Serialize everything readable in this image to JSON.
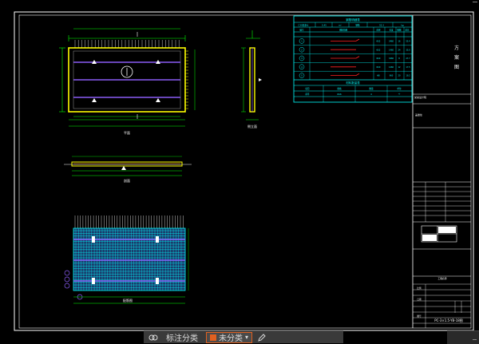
{
  "drawing": {
    "title_block_vertical_text": [
      "方",
      "案",
      "图"
    ],
    "title_block_labels": {
      "company": "某某设计院",
      "stamp_area": "盖章处",
      "drawing_no": "PC-3×1.5-YB-18图",
      "project": "工程名称",
      "scale": "比例",
      "date": "日期",
      "sheet": "图号"
    },
    "view_labels": {
      "plan": "平面",
      "side": "侧立面",
      "section": "剖面",
      "rebar": "配筋图"
    },
    "table_titles": {
      "main": "钢筋明细表",
      "sub": "材料数量表"
    },
    "main_table_header": [
      "编号",
      "钢筋简图",
      "直径",
      "长度",
      "根数",
      "总长"
    ],
    "main_table_rows": [
      [
        "1",
        "Φ12",
        "3460",
        "16",
        "55.4"
      ],
      [
        "2",
        "Φ12",
        "1460",
        "24",
        "35.0"
      ],
      [
        "3",
        "Φ10",
        "3460",
        "8",
        "27.7"
      ],
      [
        "4",
        "Φ10",
        "1460",
        "12",
        "17.5"
      ],
      [
        "5",
        "Φ8",
        "960",
        "20",
        "19.2"
      ]
    ],
    "top_row": [
      "C30混凝土",
      "0.45",
      "m³",
      "钢筋",
      "52.3",
      "kg"
    ],
    "sub_table_header": [
      "项目",
      "规格",
      "数量",
      "单位"
    ],
    "sub_table_row": [
      "吊环",
      "Φ16",
      "4",
      "个"
    ]
  },
  "bottombar": {
    "tab1_label": "标注分类",
    "tab2_label": "未分类",
    "menu_symbol": "▾"
  },
  "colors": {
    "frame": "#ffffff",
    "green": "#00ff00",
    "yellow": "#ffff00",
    "cyan": "#00ffff",
    "purple": "#8a5cf6",
    "red": "#ff2020",
    "accent": "#e06020"
  }
}
